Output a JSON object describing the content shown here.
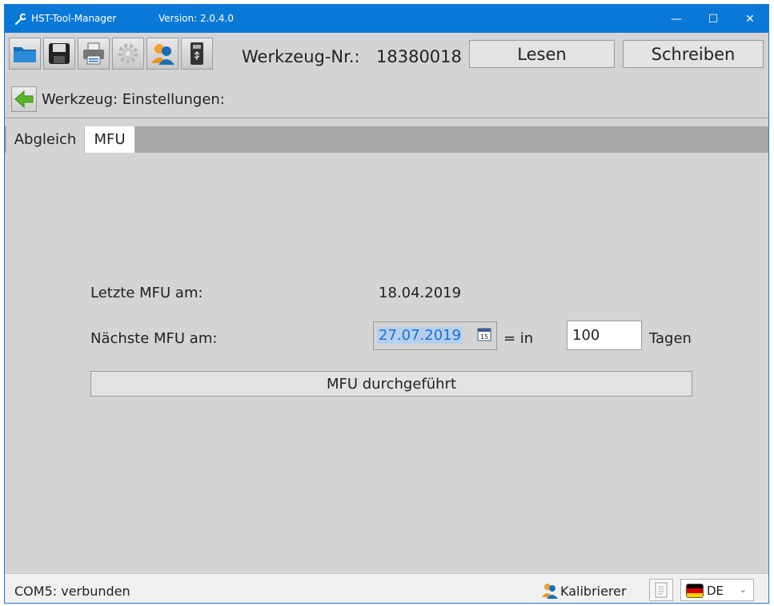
{
  "titlebar": {
    "title": "HST-Tool-Manager",
    "version": "Version: 2.0.4.0",
    "minimize": "—",
    "maximize": "☐",
    "close": "✕"
  },
  "toolbar": {
    "icons": [
      "open-folder-icon",
      "save-icon",
      "print-icon",
      "settings-icon",
      "user-icon",
      "usb-device-icon"
    ],
    "tool_label": "Werkzeug-Nr.:",
    "tool_number": "18380018",
    "read_label": "Lesen",
    "write_label": "Schreiben"
  },
  "breadcrumb": {
    "text": "Werkzeug: Einstellungen:"
  },
  "tabs": [
    {
      "label": "Abgleich",
      "active": false
    },
    {
      "label": "MFU",
      "active": true
    }
  ],
  "mfu": {
    "last_label": "Letzte MFU am:",
    "last_value": "18.04.2019",
    "next_label": "Nächste MFU am:",
    "next_date": "27.07.2019",
    "calendar_day": "15",
    "equals_in": "= in",
    "days_value": "100",
    "days_unit": "Tagen",
    "done_button": "MFU durchgeführt"
  },
  "statusbar": {
    "connection": "COM5: verbunden",
    "user_label": "Kalibrierer",
    "language": "DE"
  },
  "colors": {
    "titlebar": "#0a78d7",
    "background": "#d4d4d4",
    "tabbar": "#a8a8a8",
    "selection": "#b4cfee"
  }
}
